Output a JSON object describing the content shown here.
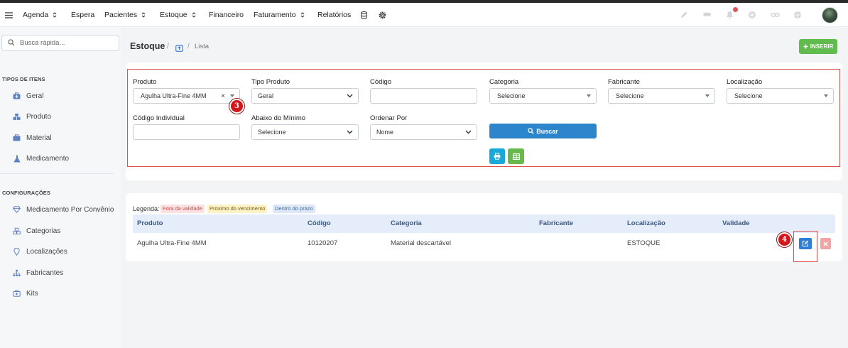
{
  "topnav": {
    "menu": [
      {
        "label": "Agenda"
      },
      {
        "label": "Espera"
      },
      {
        "label": "Pacientes"
      },
      {
        "label": "Estoque"
      },
      {
        "label": "Financeiro"
      },
      {
        "label": "Faturamento"
      },
      {
        "label": "Relatórios"
      }
    ],
    "right_icons": [
      "pen-icon",
      "mask-icon",
      "bell-icon",
      "plus-icon",
      "link-icon",
      "globe-icon"
    ]
  },
  "sidebar": {
    "search_placeholder": "Busca rápida...",
    "section_types": "TIPOS DE ITENS",
    "types": [
      "Geral",
      "Produto",
      "Material",
      "Medicamento"
    ],
    "section_config": "CONFIGURAÇÕES",
    "config": [
      "Medicamento Por Convênio",
      "Categorias",
      "Localizações",
      "Fabricantes",
      "Kits"
    ]
  },
  "breadcrumb": {
    "title": "Estoque",
    "separator": "/",
    "current": "Lista"
  },
  "toolbar": {
    "insert_label": "INSERIR"
  },
  "filters": {
    "produto": {
      "label": "Produto",
      "value": "Agulha Ultra-Fine 4MM"
    },
    "tipo_produto": {
      "label": "Tipo Produto",
      "value": "Geral"
    },
    "codigo": {
      "label": "Código",
      "value": ""
    },
    "categoria": {
      "label": "Categoria",
      "value": "Selecione"
    },
    "fabricante": {
      "label": "Fabricante",
      "value": "Selecione"
    },
    "localizacao": {
      "label": "Localização",
      "value": "Selecione"
    },
    "codigo_individual": {
      "label": "Código Individual",
      "value": ""
    },
    "abaixo_minimo": {
      "label": "Abaixo do Mínimo",
      "value": "Selecione"
    },
    "ordenar_por": {
      "label": "Ordenar Por",
      "value": "Nome"
    },
    "search_button": "Buscar"
  },
  "legend": {
    "label": "Legenda:",
    "items": [
      "Fora da validade",
      "Proximo do vencimento",
      "Dentro do prazo"
    ]
  },
  "table": {
    "columns": [
      "Produto",
      "Código",
      "Categoria",
      "Fabricante",
      "Localização",
      "Validade"
    ],
    "rows": [
      [
        "Agulha Ultra-Fine 4MM",
        "10120207",
        "Material descartável",
        "",
        "ESTOQUE",
        ""
      ]
    ]
  },
  "annotations": {
    "step_3": "3",
    "step_4": "4"
  },
  "colors": {
    "primary": "#2d86cc",
    "success": "#62bb4f",
    "info": "#19a8d8",
    "edit": "#2f7fd8",
    "danger_soft": "#f2a3a3",
    "annotation": "#d4151b",
    "table_header": "#e5edfa",
    "sidebar_icon": "#5f80c2"
  }
}
